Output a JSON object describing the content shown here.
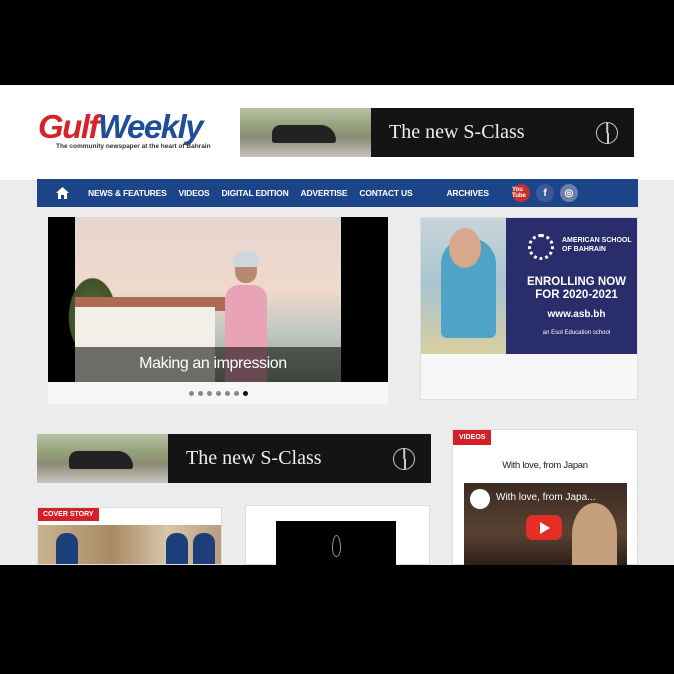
{
  "header": {
    "logo_gulf": "Gulf",
    "logo_weekly": "Weekly",
    "tagline": "The community newspaper at the heart of Bahrain"
  },
  "top_banner": {
    "title": "The new S-Class"
  },
  "nav": {
    "items": [
      "NEWS & FEATURES",
      "VIDEOS",
      "DIGITAL EDITION",
      "ADVERTISE",
      "CONTACT US",
      "ARCHIVES"
    ],
    "socials": {
      "youtube": "You Tube",
      "facebook": "f",
      "instagram": "◎"
    }
  },
  "slider": {
    "caption": "Making an impression",
    "dot_count": 7,
    "active_dot": 6
  },
  "side_ad": {
    "school": "AMERICAN SCHOOL OF BAHRAIN",
    "line1": "ENROLLING NOW",
    "line2": "FOR 2020-2021",
    "url": "www.asb.bh",
    "esol": "an Esol Education school"
  },
  "mid_banner": {
    "title": "The new S-Class"
  },
  "cover_story": {
    "tag": "COVER STORY"
  },
  "videos": {
    "tag": "VIDEOS",
    "title": "With love, from Japan",
    "thumb_title": "With love, from Japa..."
  },
  "colors": {
    "nav_bg": "#1c4589",
    "tag_red": "#d32029",
    "logo_red": "#d7222a",
    "logo_blue": "#1e4d99"
  }
}
